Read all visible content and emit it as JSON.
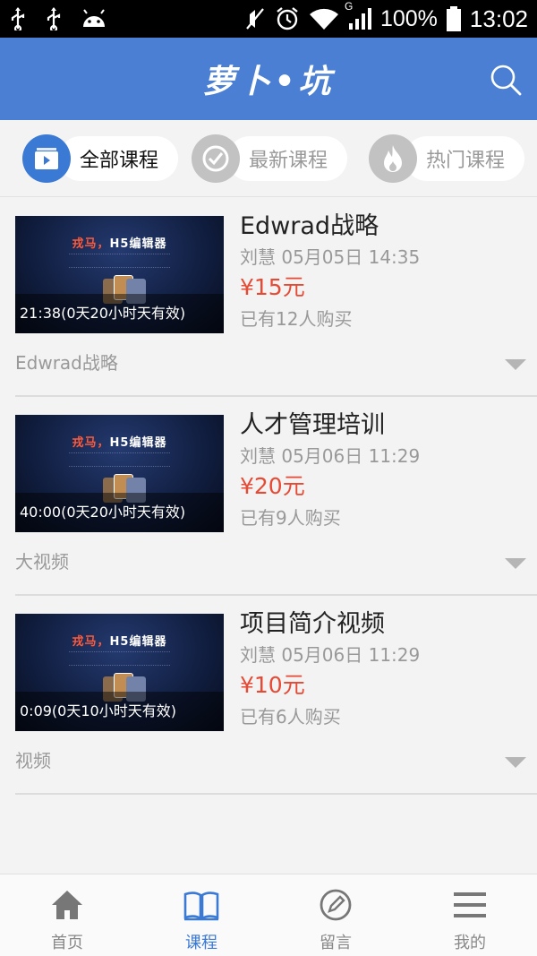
{
  "status_bar": {
    "battery": "100%",
    "time": "13:02",
    "network": "G"
  },
  "header": {
    "title": "萝卜•坑"
  },
  "tabs": [
    {
      "label": "全部课程",
      "active": true
    },
    {
      "label": "最新课程",
      "active": false
    },
    {
      "label": "热门课程",
      "active": false
    }
  ],
  "thumbnail": {
    "title_red": "戎马，",
    "title_white": "H5编辑器"
  },
  "courses": [
    {
      "title": "Edwrad战略",
      "meta": "刘慧 05月05日 14:35",
      "price": "¥15元",
      "buyers": "已有12人购买",
      "duration": "21:38(0天20小时天有效)",
      "category": "Edwrad战略"
    },
    {
      "title": "人才管理培训",
      "meta": "刘慧 05月06日 11:29",
      "price": "¥20元",
      "buyers": "已有9人购买",
      "duration": "40:00(0天20小时天有效)",
      "category": "大视频"
    },
    {
      "title": "项目简介视频",
      "meta": "刘慧 05月06日 11:29",
      "price": "¥10元",
      "buyers": "已有6人购买",
      "duration": "0:09(0天10小时天有效)",
      "category": "视频"
    }
  ],
  "bottom_nav": [
    {
      "label": "首页",
      "icon": "home-icon",
      "active": false
    },
    {
      "label": "课程",
      "icon": "book-icon",
      "active": true
    },
    {
      "label": "留言",
      "icon": "pencil-icon",
      "active": false
    },
    {
      "label": "我的",
      "icon": "menu-icon",
      "active": false
    }
  ],
  "colors": {
    "primary": "#4a7fd3",
    "price": "#e74a34",
    "active_tab": "#3b7ad4"
  }
}
